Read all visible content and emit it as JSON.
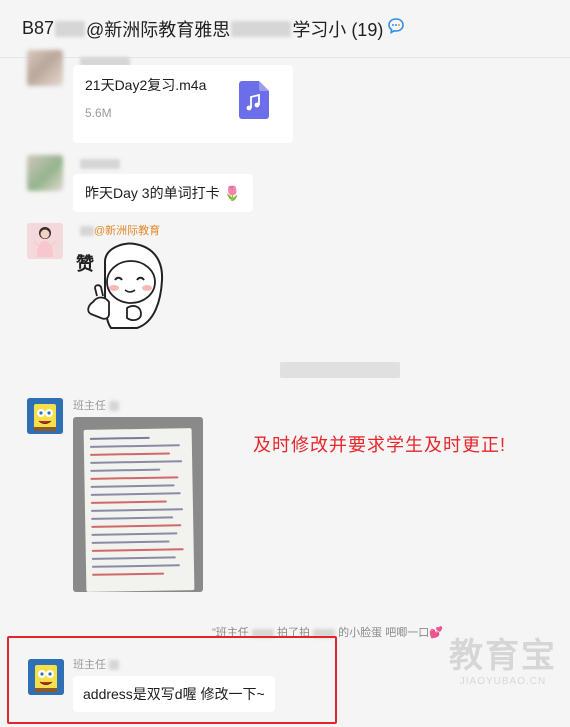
{
  "header": {
    "title_prefix": "B87",
    "title_middle": "@新洲际教育雅思",
    "title_suffix": "学习小 (19)",
    "chat_icon": "chat-bubble-icon"
  },
  "messages": {
    "file": {
      "name": "21天Day2复习.m4a",
      "size": "5.6M",
      "icon": "music-file-icon"
    },
    "text1": {
      "text": "昨天Day 3的单词打卡",
      "emoji": "🌷"
    },
    "sticker": {
      "sender": "@新洲际教育",
      "caption": "赞"
    },
    "image_msg": {
      "sender": "班主任"
    },
    "system": {
      "part1": "\"班主任",
      "part2": "拍了拍",
      "part3": "的小脸蛋 吧唧一口💕"
    },
    "text2": {
      "sender": "班主任",
      "text": "address是双写d喔 修改一下~"
    }
  },
  "annotation": "及时修改并要求学生及时更正!",
  "watermark": {
    "title": "教育宝",
    "url": "JIAOYUBAO.CN"
  },
  "colors": {
    "background": "#f5f5f5",
    "bubble": "#ffffff",
    "annotation_red": "#e8262a",
    "file_icon": "#6b6ee8"
  }
}
